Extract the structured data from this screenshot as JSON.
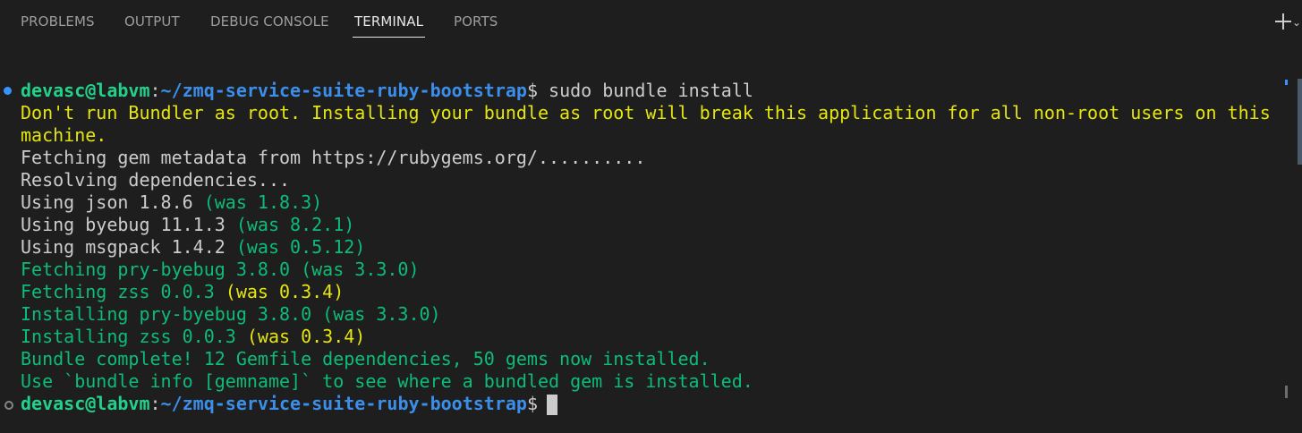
{
  "tabs": [
    {
      "label": "PROBLEMS"
    },
    {
      "label": "OUTPUT"
    },
    {
      "label": "DEBUG CONSOLE"
    },
    {
      "label": "TERMINAL"
    },
    {
      "label": "PORTS"
    }
  ],
  "actions": {
    "new_terminal_icon": "plus-icon",
    "dropdown_icon": "chevron-down-icon",
    "dropdown_glyph": "⌄"
  },
  "prompt": {
    "user_host": "devasc@labvm",
    "separator": ":",
    "path": "~/zmq-service-suite-ruby-bootstrap",
    "symbol": "$"
  },
  "terminal": {
    "command": " sudo bundle install",
    "warning_1": "Don't run Bundler as root. Installing your bundle as root will break this application for all non-root users on this",
    "warning_2": "machine.",
    "fetching_metadata": "Fetching gem metadata from https://rubygems.org/..........",
    "resolving": "Resolving dependencies...",
    "using_json": "Using json 1.8.6 ",
    "using_json_was": "(was 1.8.3)",
    "using_byebug": "Using byebug 11.1.3 ",
    "using_byebug_was": "(was 8.2.1)",
    "using_msgpack": "Using msgpack 1.4.2 ",
    "using_msgpack_was": "(was 0.5.12)",
    "fetching_pry": "Fetching pry-byebug 3.8.0 (was 3.3.0)",
    "fetching_zss": "Fetching zss 0.0.3 ",
    "fetching_zss_was": "(was 0.3.4)",
    "installing_pry": "Installing pry-byebug 3.8.0 (was 3.3.0)",
    "installing_zss": "Installing zss 0.0.3 ",
    "installing_zss_was": "(was 0.3.4)",
    "bundle_complete": "Bundle complete! 12 Gemfile dependencies, 50 gems now installed.",
    "bundle_info": "Use `bundle info [gemname]` to see where a bundled gem is installed."
  },
  "colors": {
    "background": "#1e1e1e",
    "prompt_user": "#23d18b",
    "prompt_path": "#3b8eea",
    "warning": "#e5e510",
    "success": "#0dbc79",
    "text": "#cccccc"
  }
}
